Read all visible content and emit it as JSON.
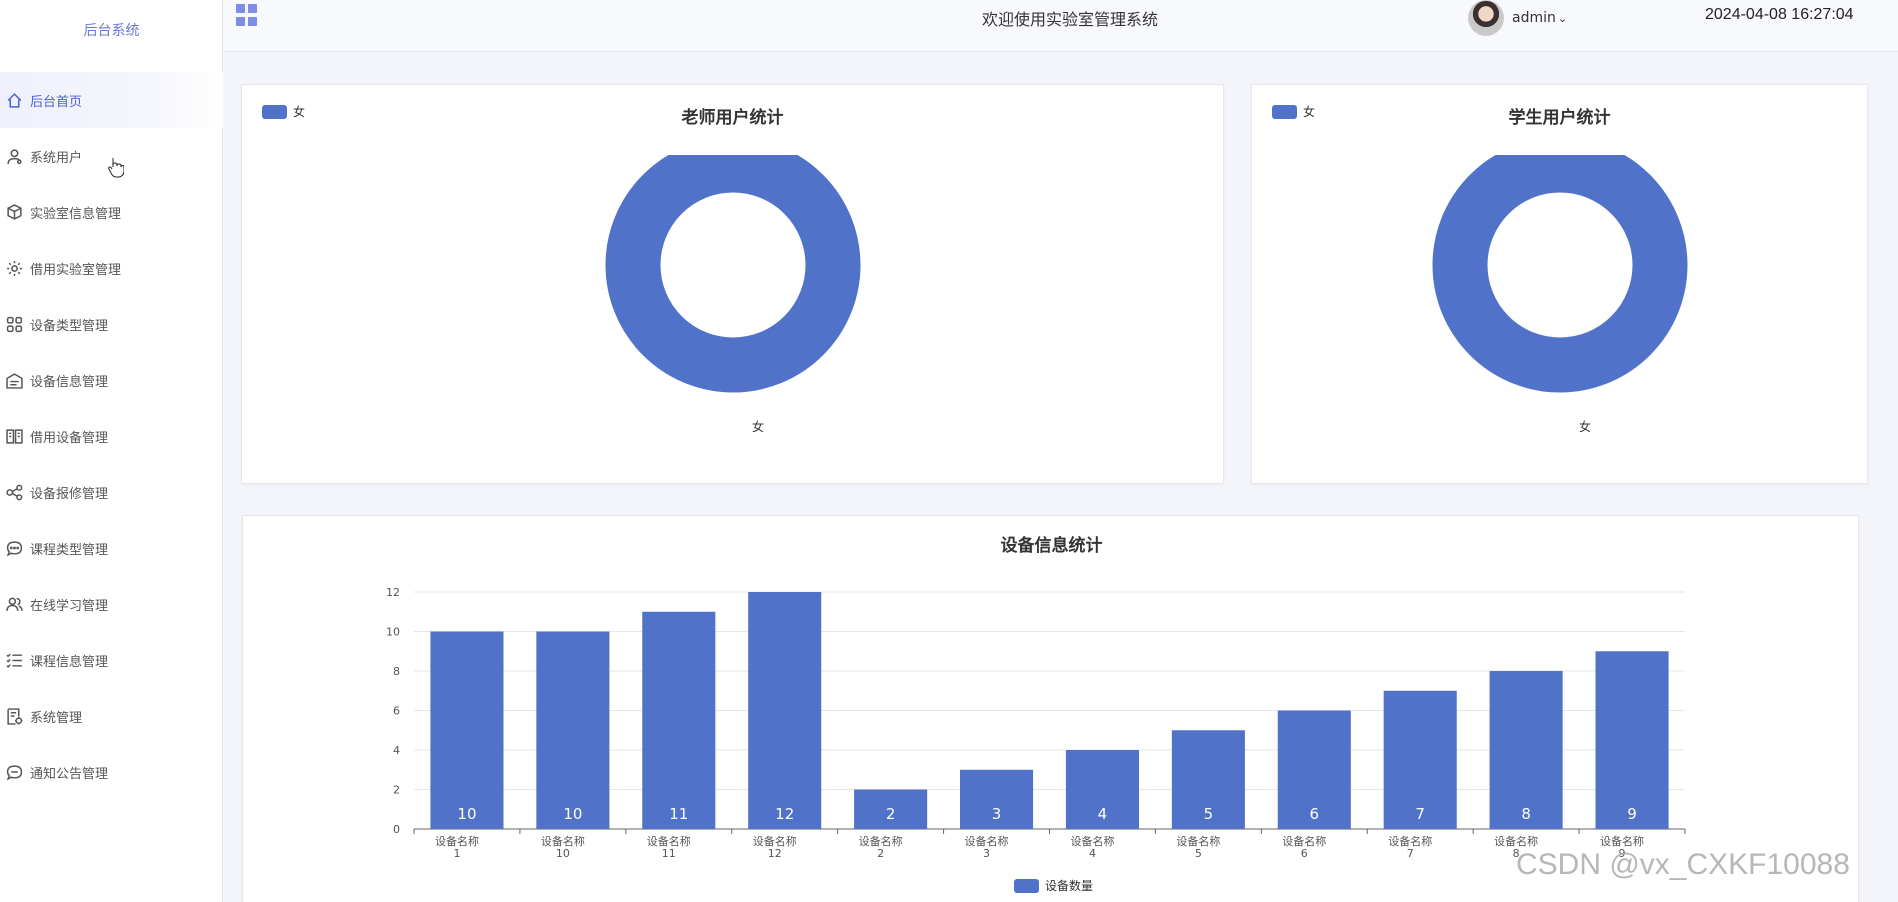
{
  "sidebar": {
    "brand": "后台系统",
    "items": [
      {
        "label": "后台首页",
        "icon": "home-icon",
        "active": true
      },
      {
        "label": "系统用户",
        "icon": "user-icon"
      },
      {
        "label": "实验室信息管理",
        "icon": "cube-icon"
      },
      {
        "label": "借用实验室管理",
        "icon": "gear-icon"
      },
      {
        "label": "设备类型管理",
        "icon": "apps-icon"
      },
      {
        "label": "设备信息管理",
        "icon": "box-icon"
      },
      {
        "label": "借用设备管理",
        "icon": "book-icon"
      },
      {
        "label": "设备报修管理",
        "icon": "share-icon"
      },
      {
        "label": "课程类型管理",
        "icon": "chat-icon"
      },
      {
        "label": "在线学习管理",
        "icon": "users-icon"
      },
      {
        "label": "课程信息管理",
        "icon": "checklist-icon"
      },
      {
        "label": "系统管理",
        "icon": "document-icon"
      },
      {
        "label": "通知公告管理",
        "icon": "message-icon"
      }
    ]
  },
  "header": {
    "title": "欢迎使用实验室管理系统",
    "username": "admin",
    "datetime": "2024-04-08 16:27:04"
  },
  "colors": {
    "accent": "#4a5fd8",
    "series": "#5172c9"
  },
  "teacher_card": {
    "title": "老师用户统计",
    "legend": "女",
    "slice_label": "女"
  },
  "student_card": {
    "title": "学生用户统计",
    "legend": "女",
    "slice_label": "女"
  },
  "watermark": "CSDN @vx_CXKF10088",
  "chart_data": [
    {
      "type": "pie",
      "title": "老师用户统计",
      "legend": [
        "女"
      ],
      "slices": [
        {
          "name": "女",
          "value": 1
        }
      ]
    },
    {
      "type": "pie",
      "title": "学生用户统计",
      "legend": [
        "女"
      ],
      "slices": [
        {
          "name": "女",
          "value": 1
        }
      ]
    },
    {
      "type": "bar",
      "title": "设备信息统计",
      "categories": [
        "设备名称\n1",
        "设备名称\n10",
        "设备名称\n11",
        "设备名称\n12",
        "设备名称\n2",
        "设备名称\n3",
        "设备名称\n4",
        "设备名称\n5",
        "设备名称\n6",
        "设备名称\n7",
        "设备名称\n8",
        "设备名称\n9"
      ],
      "series": [
        {
          "name": "设备数量",
          "values": [
            10,
            10,
            11,
            12,
            2,
            3,
            4,
            5,
            6,
            7,
            8,
            9
          ]
        }
      ],
      "ylim": [
        0,
        12
      ],
      "yticks": [
        0,
        2,
        4,
        6,
        8,
        10,
        12
      ],
      "grid": true,
      "legend_position": "bottom-center"
    }
  ]
}
